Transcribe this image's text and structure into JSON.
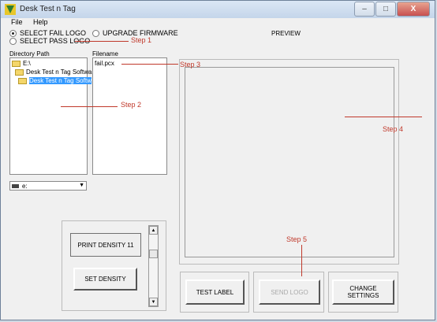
{
  "window": {
    "title": "Desk Test n Tag",
    "minimize": "–",
    "maximize": "□",
    "close": "X"
  },
  "menu": {
    "file": "File",
    "help": "Help"
  },
  "options": {
    "select_fail_logo": "SELECT FAIL LOGO",
    "select_pass_logo": "SELECT PASS LOGO",
    "upgrade_firmware": "UPGRADE FIRMWARE",
    "selected": "select_fail_logo"
  },
  "labels": {
    "directory_path": "Directory Path",
    "filename": "Filename",
    "preview": "PREVIEW"
  },
  "directory_tree": [
    {
      "label": "E:\\"
    },
    {
      "label": "Desk Test n Tag Softwa"
    },
    {
      "label": "Desk Test n Tag Softw"
    }
  ],
  "files": [
    "fail.pcx"
  ],
  "drive": {
    "value": "e:",
    "arrow": "▼"
  },
  "settings": {
    "print_density": "PRINT DENSITY 11",
    "set_density": "SET DENSITY",
    "up": "▲",
    "down": "▼"
  },
  "actions": {
    "test_label": "TEST LABEL",
    "send_logo": "SEND LOGO",
    "change_settings": "CHANGE SETTINGS"
  },
  "annotations": {
    "step1": "Step 1",
    "step2": "Step 2",
    "step3": "Step 3",
    "step4": "Step 4",
    "step5": "Step 5"
  },
  "colors": {
    "annotation": "#c0392b",
    "selection": "#3399ff"
  }
}
